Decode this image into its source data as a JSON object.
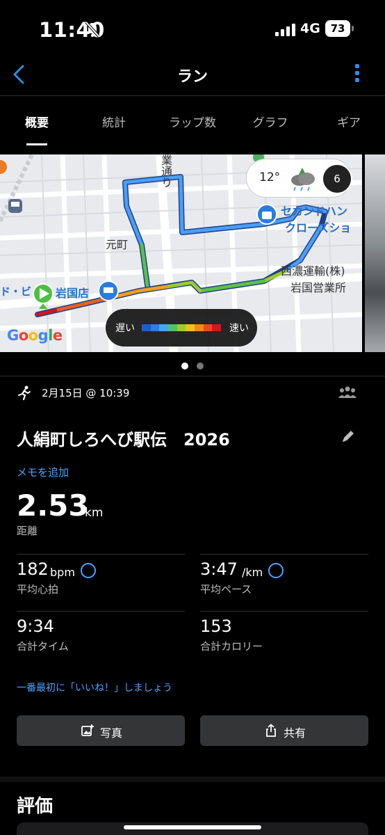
{
  "status_bar": {
    "time": "11:40",
    "network": "4G",
    "battery": "73"
  },
  "nav": {
    "title": "ラン"
  },
  "tabs": [
    {
      "label": "概要",
      "active": true
    },
    {
      "label": "統計",
      "active": false
    },
    {
      "label": "ラップ数",
      "active": false
    },
    {
      "label": "グラフ",
      "active": false
    },
    {
      "label": "ギア",
      "active": false
    }
  ],
  "map": {
    "labels": {
      "street": "業通り",
      "motomachi": "元町",
      "store1": "岩国店",
      "store1_prefix": "ド・ビ",
      "second_hand_1": "セカンドハン",
      "second_hand_2": "クローズショ",
      "company_1": "西濃運輸(株)",
      "company_2": "岩国営業所",
      "google": "Google"
    },
    "weather": {
      "temp": "12°",
      "wind": "6"
    },
    "legend": {
      "slow": "遅い",
      "fast": "速い",
      "colors": [
        "#1a5fc4",
        "#2e7fe0",
        "#4aa3ff",
        "#52c06a",
        "#9ccc2a",
        "#f0c020",
        "#f08a20",
        "#e84a20",
        "#d01818"
      ]
    }
  },
  "activity": {
    "date": "2月15日 @ 10:39",
    "title": "人絹町しろへび駅伝　2026",
    "add_memo": "メモを追加"
  },
  "distance": {
    "value": "2.53",
    "unit": "km",
    "label": "距離"
  },
  "stats": {
    "heart_rate": {
      "value": "182",
      "unit": "bpm",
      "label": "平均心拍"
    },
    "pace": {
      "value": "3:47",
      "unit": "/km",
      "label": "平均ペース"
    },
    "total_time": {
      "value": "9:34",
      "label": "合計タイム"
    },
    "calories": {
      "value": "153",
      "label": "合計カロリー"
    }
  },
  "like_prompt": "一番最初に「いいね！」しましょう",
  "buttons": {
    "photo": "写真",
    "share": "共有"
  },
  "rating": {
    "title": "評価"
  }
}
